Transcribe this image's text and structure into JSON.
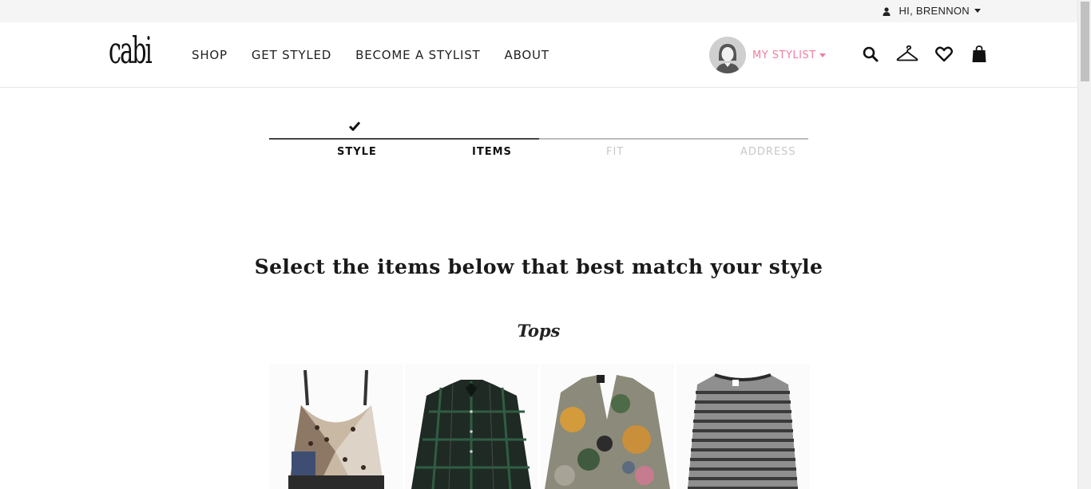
{
  "topbar": {
    "greeting": "HI, BRENNON"
  },
  "header": {
    "logo": "cabi",
    "nav": [
      "SHOP",
      "GET STYLED",
      "BECOME A STYLIST",
      "ABOUT"
    ],
    "stylist_label": "MY STYLIST",
    "accent_color": "#f07d9e"
  },
  "steps": {
    "items": [
      {
        "label": "STYLE",
        "state": "complete"
      },
      {
        "label": "ITEMS",
        "state": "current"
      },
      {
        "label": "FIT",
        "state": "upcoming"
      },
      {
        "label": "ADDRESS",
        "state": "upcoming"
      }
    ]
  },
  "main": {
    "heading": "Select the items below that best match your style",
    "category": "Tops",
    "products": [
      {
        "name": "leopard-print-cami-top"
      },
      {
        "name": "green-plaid-shirt"
      },
      {
        "name": "floral-snakeskin-blouse"
      },
      {
        "name": "grey-striped-tee"
      }
    ]
  }
}
